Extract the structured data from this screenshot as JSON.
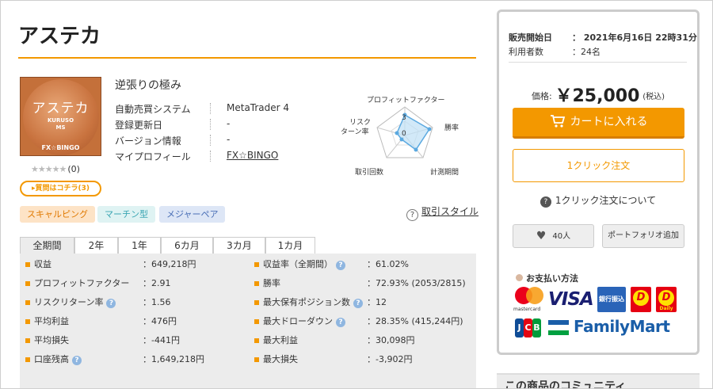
{
  "product": {
    "title": "アステカ",
    "tagline": "逆張りの極み",
    "thumb": {
      "line1": "アステカ",
      "line2": "KURUSO",
      "line3": "MS",
      "line4": "FX☆BINGO"
    },
    "stars": "★★★★★",
    "review_count": "(0)",
    "question_button": "▸質問はコチラ(3)",
    "info": [
      {
        "label": "自動売買システム",
        "value": "MetaTrader 4"
      },
      {
        "label": "登録更新日",
        "value": "-"
      },
      {
        "label": "バージョン情報",
        "value": "-"
      },
      {
        "label": "マイプロフィール",
        "value": "FX☆BINGO"
      }
    ],
    "radar_labels": {
      "profit_factor": "プロフィットファクター",
      "win_rate": "勝率",
      "period": "計測期間",
      "trades": "取引回数",
      "risk_return_1": "リスク",
      "risk_return_2": "ターン率",
      "tick_a": "3",
      "tick_b": "0"
    },
    "tags": [
      "スキャルピング",
      "マーチン型",
      "メジャーペア"
    ],
    "trade_style": "取引スタイル"
  },
  "tabs": [
    "全期間",
    "2年",
    "1年",
    "6カ月",
    "3カ月",
    "1カ月"
  ],
  "stats": {
    "left": [
      {
        "label": "収益",
        "value": "：649,218円",
        "help": false
      },
      {
        "label": "プロフィットファクター",
        "value": "：2.91",
        "help": false
      },
      {
        "label": "リスクリターン率",
        "value": "：1.56",
        "help": true
      },
      {
        "label": "平均利益",
        "value": "：476円",
        "help": false
      },
      {
        "label": "平均損失",
        "value": "：-441円",
        "help": false
      },
      {
        "label": "口座残高",
        "value": "：1,649,218円",
        "help": true
      }
    ],
    "right": [
      {
        "label": "収益率（全期間）",
        "value": "：61.02%",
        "help": true
      },
      {
        "label": "勝率",
        "value": "：72.93% (2053/2815)",
        "help": false
      },
      {
        "label": "最大保有ポジション数",
        "value": "：12",
        "help": true
      },
      {
        "label": "最大ドローダウン",
        "value": "：28.35% (415,244円)",
        "help": true
      },
      {
        "label": "最大利益",
        "value": "：30,098円",
        "help": false
      },
      {
        "label": "最大損失",
        "value": "：-3,902円",
        "help": false
      }
    ]
  },
  "sidebar": {
    "sale_start_label": "販売開始日",
    "sale_start_value": "：  2021年6月16日 22時31分",
    "users_label": "利用者数",
    "users_value": "：24名",
    "price_label": "価格:",
    "price_value": "￥25,000",
    "price_tax": "(税込)",
    "cart_button": "カートに入れる",
    "oneclick_button": "1クリック注文",
    "about_oneclick": "1クリック注文について",
    "like_count": "40人",
    "portfolio_button": "ポートフォリオ追加",
    "payment_title": "お支払い方法",
    "payments": {
      "mastercard": "mastercard",
      "visa": "VISA",
      "bank": "銀行振込",
      "daily_label": "Daily",
      "jcb": [
        "J",
        "C",
        "B"
      ],
      "familymart": "FamilyMart"
    },
    "community_title": "この商品のコミュニティ"
  },
  "colors": {
    "accent": "#f39800",
    "bar_bg": "#ececec"
  }
}
